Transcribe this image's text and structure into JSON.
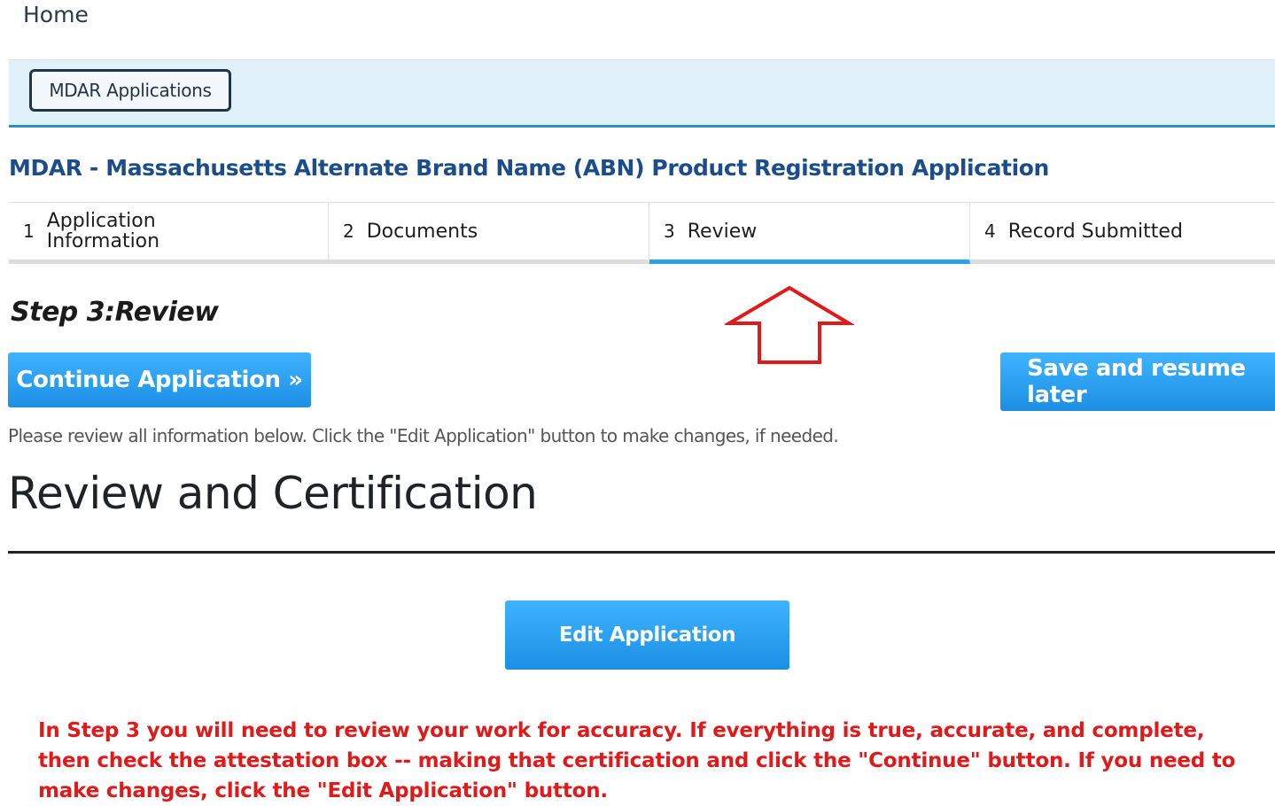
{
  "header": {
    "home_label": "Home"
  },
  "tabbar": {
    "active_tab_label": "MDAR Applications"
  },
  "application": {
    "title": "MDAR - Massachusetts Alternate Brand Name (ABN) Product Registration Application"
  },
  "steps": [
    {
      "number": "1",
      "label": "Application\nInformation",
      "active": false
    },
    {
      "number": "2",
      "label": "Documents",
      "active": false
    },
    {
      "number": "3",
      "label": "Review",
      "active": true
    },
    {
      "number": "4",
      "label": "Record Submitted",
      "active": false
    }
  ],
  "step_heading": "Step 3:Review",
  "buttons": {
    "continue_label": "Continue Application »",
    "save_label": "Save and resume later",
    "edit_label": "Edit Application"
  },
  "instructions": "Please review all information below. Click the \"Edit Application\" button to make changes, if needed.",
  "section_title": "Review and Certification",
  "note": "In Step 3 you will need to review your work for accuracy.  If everything is true, accurate, and complete, then check the attestation box -- making that certification and click the \"Continue\" button.  If you need to make changes, click the \"Edit Application\" button.",
  "colors": {
    "accent_blue": "#1c8fe4",
    "step_active": "#2aa3e6",
    "title_blue": "#1b4d8a",
    "annotation_red": "#e01a1a"
  },
  "icons": {
    "annotation_arrow": "up-arrow-outline-icon"
  }
}
